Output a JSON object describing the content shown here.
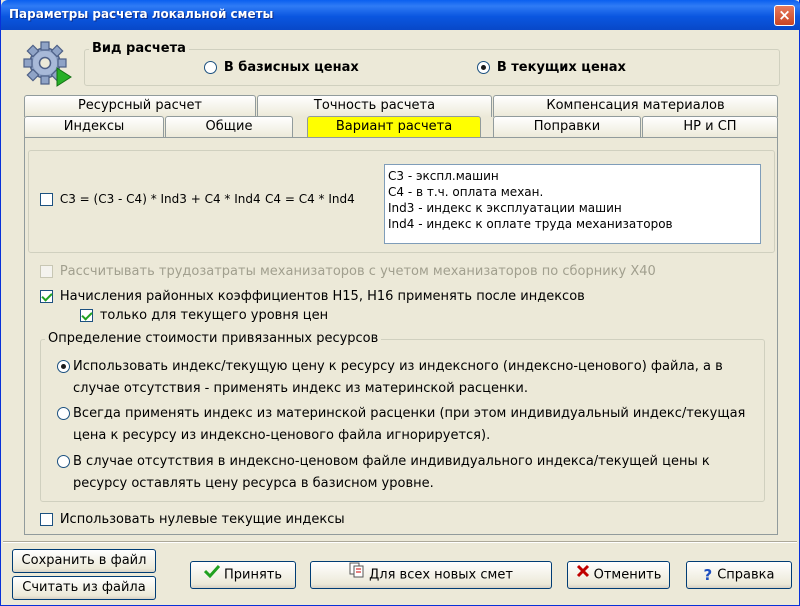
{
  "window": {
    "title": "Параметры расчета локальной сметы",
    "close_icon": "×"
  },
  "calc_type": {
    "group_title": "Вид расчета",
    "option_base": "В базисных ценах",
    "option_current": "В текущих ценах",
    "selected": "current"
  },
  "tabs": {
    "row_back": [
      "Ресурсный расчет",
      "Точность расчета",
      "Компенсация материалов"
    ],
    "row_front": [
      "Индексы",
      "Общие",
      "Вариант расчета",
      "Поправки",
      "НР и СП"
    ],
    "active": "Вариант расчета"
  },
  "formula": {
    "checkbox_label": "С3 = (С3 - С4) * Ind3 + C4 * Ind4",
    "checked": false,
    "formula_c4": "С4 = С4 * Ind4",
    "notes": [
      "С3 - экспл.машин",
      "С4 - в т.ч. оплата механ.",
      "Ind3 - индекс к эксплуатации машин",
      "Ind4 - индекс к оплате труда механизаторов"
    ]
  },
  "options": {
    "labor_mech": {
      "label": "Рассчитывать трудозатраты механизаторов с учетом механизаторов по сборнику Х40",
      "checked": false,
      "disabled": true
    },
    "regional_coeff": {
      "label": "Начисления районных коэффициентов Н15, Н16 применять после индексов",
      "checked": true
    },
    "current_level_only": {
      "label": "только для текущего уровня цен",
      "checked": true
    },
    "zero_indices": {
      "label": "Использовать нулевые текущие индексы",
      "checked": false
    }
  },
  "resource_cost": {
    "group_title": "Определение стоимости привязанных ресурсов",
    "selected": 0,
    "options": [
      [
        "Использовать индекс/текущую цену к ресурсу из индексного (индексно-ценового) файла, а в",
        "случае отсутствия - применять индекс из материнской расценки."
      ],
      [
        "Всегда применять индекс из материнской расценки (при этом индивидуальный индекс/текущая",
        "цена к ресурсу из индексно-ценового файла игнорируется)."
      ],
      [
        "В случае отсутствия в индексно-ценовом файле индивидуального индекса/текущей цены к",
        "ресурсу оставлять цену ресурса в базисном уровне."
      ]
    ]
  },
  "buttons": {
    "save_file": "Сохранить в файл",
    "load_file": "Считать из файла",
    "accept": "Принять",
    "all_new": "Для всех новых смет",
    "cancel": "Отменить",
    "help": "Справка",
    "help_glyph": "?"
  },
  "colors": {
    "active_tab": "#ffff00",
    "title_bar": "#0a5ff0",
    "check_mark": "#21a121",
    "cancel_icon": "#c00000",
    "help_icon": "#1f4fc0"
  }
}
